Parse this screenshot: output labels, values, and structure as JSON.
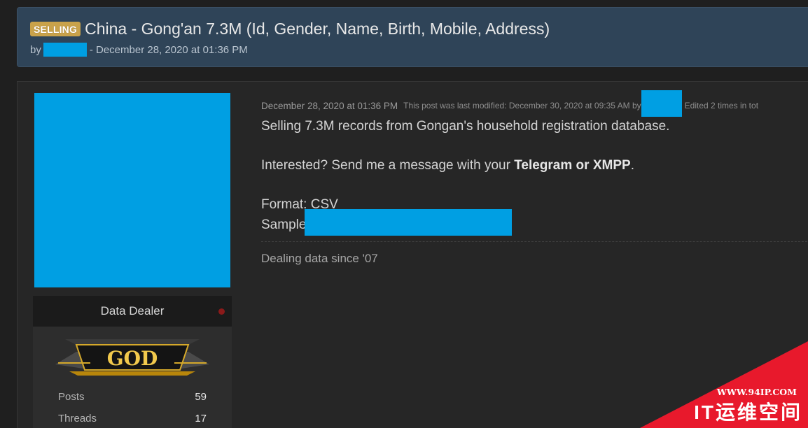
{
  "thread": {
    "prefix": "SELLING",
    "title": "China - Gong'an 7.3M (Id, Gender, Name, Birth, Mobile, Address)",
    "by_label": "by",
    "date_text": "- December 28, 2020 at 01:36 PM"
  },
  "author": {
    "usertitle": "Data Dealer",
    "rank_badge_text": "GOD",
    "stats": [
      {
        "label": "Posts",
        "value": "59"
      },
      {
        "label": "Threads",
        "value": "17"
      }
    ]
  },
  "post": {
    "date": "December 28, 2020 at 01:36 PM",
    "modified_text": "This post was last modified: December 30, 2020 at 09:35 AM by",
    "edited_text": "Edited 2 times in tot",
    "line1": "Selling 7.3M records from Gongan's household registration database.",
    "line2_prefix": "Interested? Send me a message with your ",
    "line2_bold": "Telegram or XMPP",
    "line2_suffix": ".",
    "format_line": "Format: CSV",
    "sample_label": "Sample",
    "signature": "Dealing data since '07"
  },
  "watermark": {
    "url": "WWW.94IP.COM",
    "name": "IT运维空间"
  },
  "colors": {
    "header_bg": "#2f4458",
    "badge": "#c9a24a",
    "redaction": "#009fe3",
    "watermark_red": "#e8192c"
  }
}
